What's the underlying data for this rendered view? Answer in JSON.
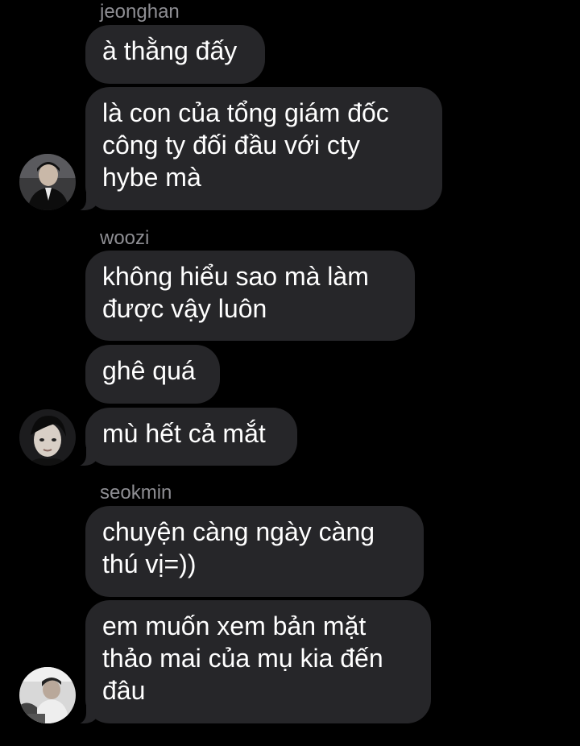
{
  "messages": [
    {
      "sender": "jeonghan",
      "bubbles": [
        "à thằng đấy",
        "là con của tổng giám đốc\ncông ty đối đầu với cty\nhybe mà"
      ],
      "avatar_icon": "person-avatar-dark-suit"
    },
    {
      "sender": "woozi",
      "bubbles": [
        "không hiểu sao mà làm\nđược vậy luôn",
        "ghê quá",
        "mù hết cả mắt"
      ],
      "avatar_icon": "person-avatar-face"
    },
    {
      "sender": "seokmin",
      "bubbles": [
        "chuyện càng ngày càng\nthú vị=))",
        "em muốn xem bản mặt\nthảo mai của mụ kia đến\nđâu"
      ],
      "avatar_icon": "person-avatar-light-shirt"
    }
  ],
  "colors": {
    "background": "#000000",
    "bubble": "#262629",
    "text": "#ffffff",
    "sender": "#8e8e93"
  }
}
